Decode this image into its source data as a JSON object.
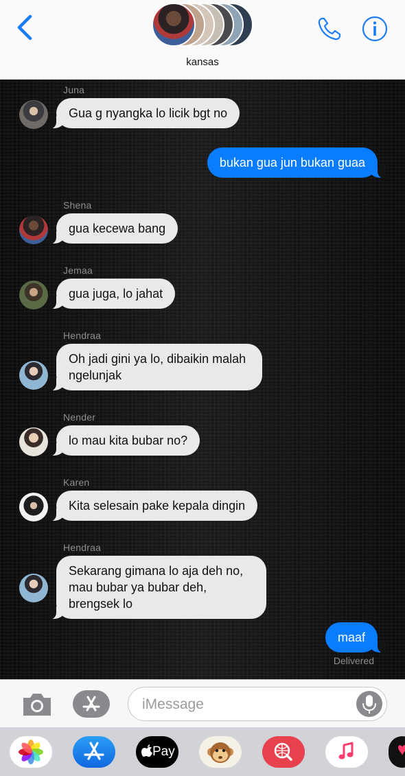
{
  "header": {
    "group_name": "kansas",
    "back_icon": "chevron-left-icon",
    "call_icon": "phone-icon",
    "info_icon": "info-icon",
    "accent": "#1a7cf5"
  },
  "messages": [
    {
      "sender": "Juna",
      "text": "Gua g nyangka lo licik bgt no",
      "direction": "in"
    },
    {
      "text": "bukan gua jun bukan guaa",
      "direction": "out"
    },
    {
      "sender": "Shena",
      "text": "gua kecewa bang",
      "direction": "in"
    },
    {
      "sender": "Jemaa",
      "text": "gua juga, lo jahat",
      "direction": "in"
    },
    {
      "sender": "Hendraa",
      "text": "Oh jadi gini ya lo, dibaikin malah ngelunjak",
      "direction": "in"
    },
    {
      "sender": "Nender",
      "text": "lo mau kita bubar no?",
      "direction": "in"
    },
    {
      "sender": "Karen",
      "text": "Kita selesain pake kepala dingin",
      "direction": "in"
    },
    {
      "sender": "Hendraa",
      "text": "Sekarang gimana lo aja deh no, mau bubar ya bubar deh, brengsek lo",
      "direction": "in"
    },
    {
      "text": "maaf",
      "direction": "out",
      "status": "Delivered"
    }
  ],
  "composer": {
    "placeholder": "iMessage",
    "camera_icon": "camera-icon",
    "appstore_icon": "app-store-icon",
    "mic_icon": "microphone-icon"
  },
  "drawer": {
    "apple_pay_label": "Pay",
    "apps": [
      "photos-icon",
      "app-store-icon",
      "apple-pay-icon",
      "animoji-icon",
      "web-search-icon",
      "music-icon",
      "digital-touch-icon"
    ]
  },
  "colors": {
    "outgoing_bubble": "#0a7cff",
    "incoming_bubble": "#e9e9eb",
    "chat_background": "#141414"
  }
}
